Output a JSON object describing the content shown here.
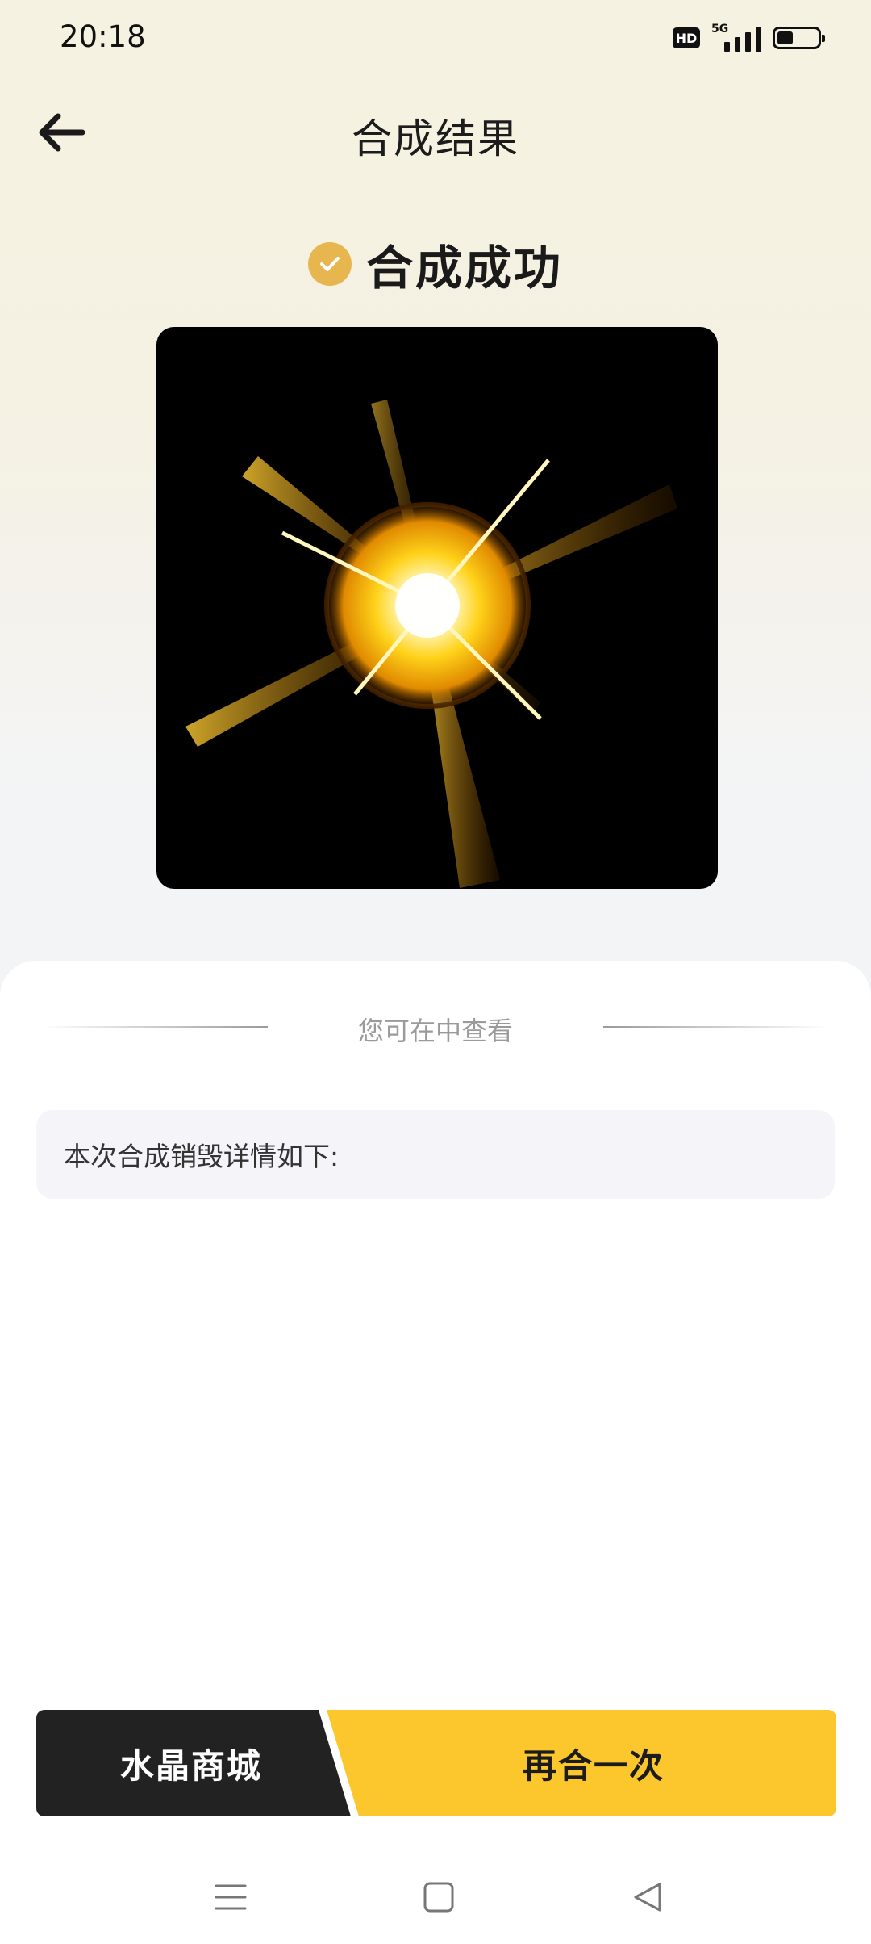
{
  "status_bar": {
    "time": "20:18",
    "hd_label": "HD",
    "network": "5G",
    "battery_level": 0.4
  },
  "header": {
    "title": "合成结果",
    "back_icon": "arrow-left-icon"
  },
  "result": {
    "status_text": "合成成功",
    "status_icon": "check-circle-icon",
    "accent_color": "#e8b64e"
  },
  "sheet": {
    "hint": "您可在中查看",
    "detail_title": "本次合成销毁详情如下:"
  },
  "buttons": {
    "shop_label": "水晶商城",
    "again_label": "再合一次",
    "again_color": "#fcc72c",
    "shop_color": "#222222"
  },
  "nav": {
    "menu_icon": "menu-icon",
    "home_icon": "square-home-icon",
    "back_icon": "triangle-back-icon"
  }
}
